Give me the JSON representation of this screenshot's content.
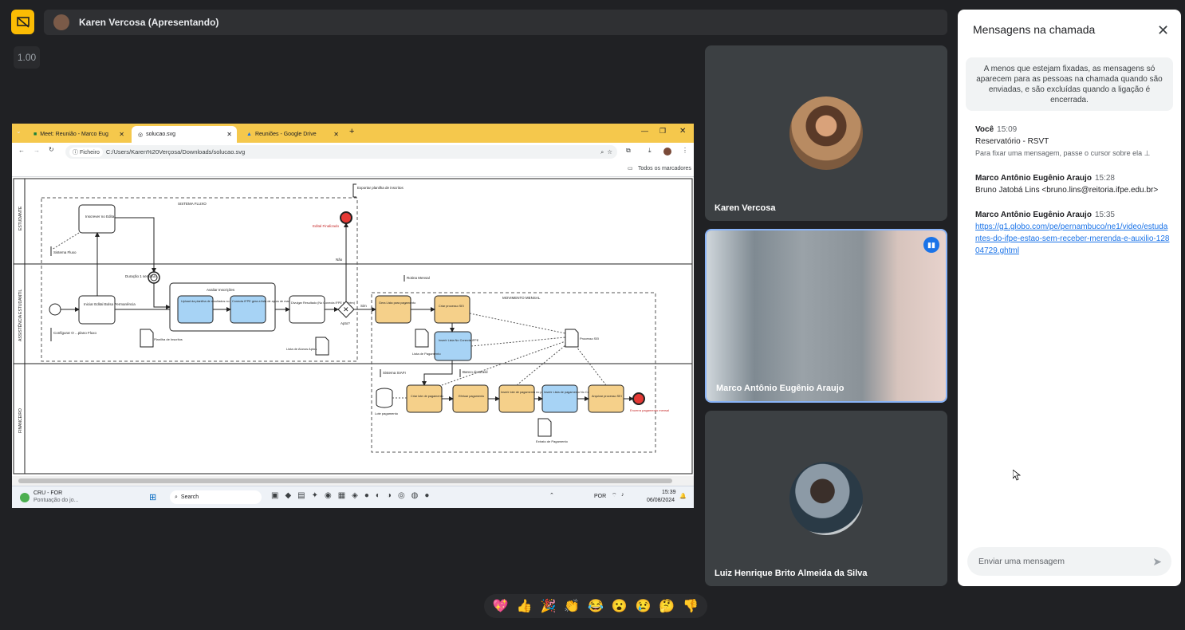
{
  "presenter": {
    "label": "Karen Vercosa (Apresentando)"
  },
  "zoom": "1.00",
  "browser": {
    "tabs": [
      {
        "label": "Meet: Reunião - Marco Eug"
      },
      {
        "label": "solucao.svg"
      },
      {
        "label": "Reuniões - Google Drive"
      }
    ],
    "file_chip": "Ficheiro",
    "url": "C:/Users/Karen%20Verçosa/Downloads/solucao.svg",
    "bookmarks": "Todos os marcadores"
  },
  "diagram": {
    "lanes": [
      "ESTUDANTE",
      "ASSISTÊNCIA ESTUDANTIL",
      "FINANCEIRO"
    ],
    "labels": {
      "sistema_fluxo": "SISTEMA FLUXO",
      "exportar": "Exportar planilha de inscritos",
      "inscrever": "Inscrever no Edital",
      "sistema_fluxo2": "Sistema Fluxo",
      "edital_finalizado": "Edital Finalizado",
      "duracao": "Duração 1 semana",
      "avaliar": "Avaliar Inscrições",
      "upload": "Upload da planilha de resultados no Conecta IFPE",
      "conecta": "Conecta IFPE gera a lista de aptos de maneira visual, csv e xls",
      "divulgar": "Divulgar Resultado (No Conecta IFPE também)",
      "iniciar": "Iniciar Edital Bolsa Permanência",
      "configurar": "Configurar O ...plano Fluxo",
      "planilha": "Planilha de Inscritos",
      "lista_alunos": "Lista de Alunos Aptos",
      "apto": "Apto?",
      "sim": "Sim",
      "nao": "Não",
      "rotina": "Rotina Mensal",
      "movimento": "MOVIMENTO MENSAL",
      "gera_lista": "Gera Lista para pagamento",
      "criar_processo": "Criar processo SEI",
      "inserir_lista": "Inserir Lista No Conecta IFPE",
      "lista_pagamento": "Lista de Pagamento",
      "processo_sei": "Processo SEI",
      "sistema_siafi": "Sistema SIAFI",
      "banco": "Banco do Brasil",
      "lote_pagamento": "Lote pagamento",
      "criar_lote": "Criar lote de pagamento",
      "efetuar": "Efetuar pagamento",
      "inserir_lote": "Inserir lote de pagamento no processo SEI",
      "inserir_lista2": "Inserir Lista de pagamento No Conecta IFPE",
      "arquivar": "Arquivar processo SEI",
      "extrato": "Extrato de Pagamento",
      "encerra": "Encerra pagamento mensal",
      "financeiro": "FINANCEIRO"
    }
  },
  "taskbar": {
    "weather_title": "CRU - FOR",
    "weather_sub": "Pontuação do jo...",
    "search": "Search",
    "lang": "POR",
    "time": "15:39",
    "date": "06/08/2024"
  },
  "participants": [
    {
      "name": "Karen Vercosa"
    },
    {
      "name": "Marco Antônio Eugênio Araujo"
    },
    {
      "name": "Luiz Henrique Brito Almeida da Silva"
    }
  ],
  "chat": {
    "title": "Mensagens na chamada",
    "note": "A menos que estejam fixadas, as mensagens só aparecem para as pessoas na chamada quando são enviadas, e são excluídas quando a ligação é encerrada.",
    "messages": [
      {
        "sender": "Você",
        "time": "15:09",
        "text": "Reservatório - RSVT",
        "hint": "Para fixar uma mensagem, passe o cursor sobre ela"
      },
      {
        "sender": "Marco Antônio Eugênio Araujo",
        "time": "15:28",
        "text": "Bruno Jatobá Lins <bruno.lins@reitoria.ifpe.edu.br>"
      },
      {
        "sender": "Marco Antônio Eugênio Araujo",
        "time": "15:35",
        "link": "https://g1.globo.com/pe/pernambuco/ne1/video/estudantes-do-ifpe-estao-sem-receber-merenda-e-auxilio-12804729.ghtml"
      }
    ],
    "input_placeholder": "Enviar uma mensagem"
  },
  "reactions": [
    "💖",
    "👍",
    "🎉",
    "👏",
    "😂",
    "😮",
    "😢",
    "🤔",
    "👎"
  ],
  "colors": {
    "accent_yellow": "#fbbc04",
    "active_border": "#8ab4f8",
    "link": "#1a73e8"
  }
}
